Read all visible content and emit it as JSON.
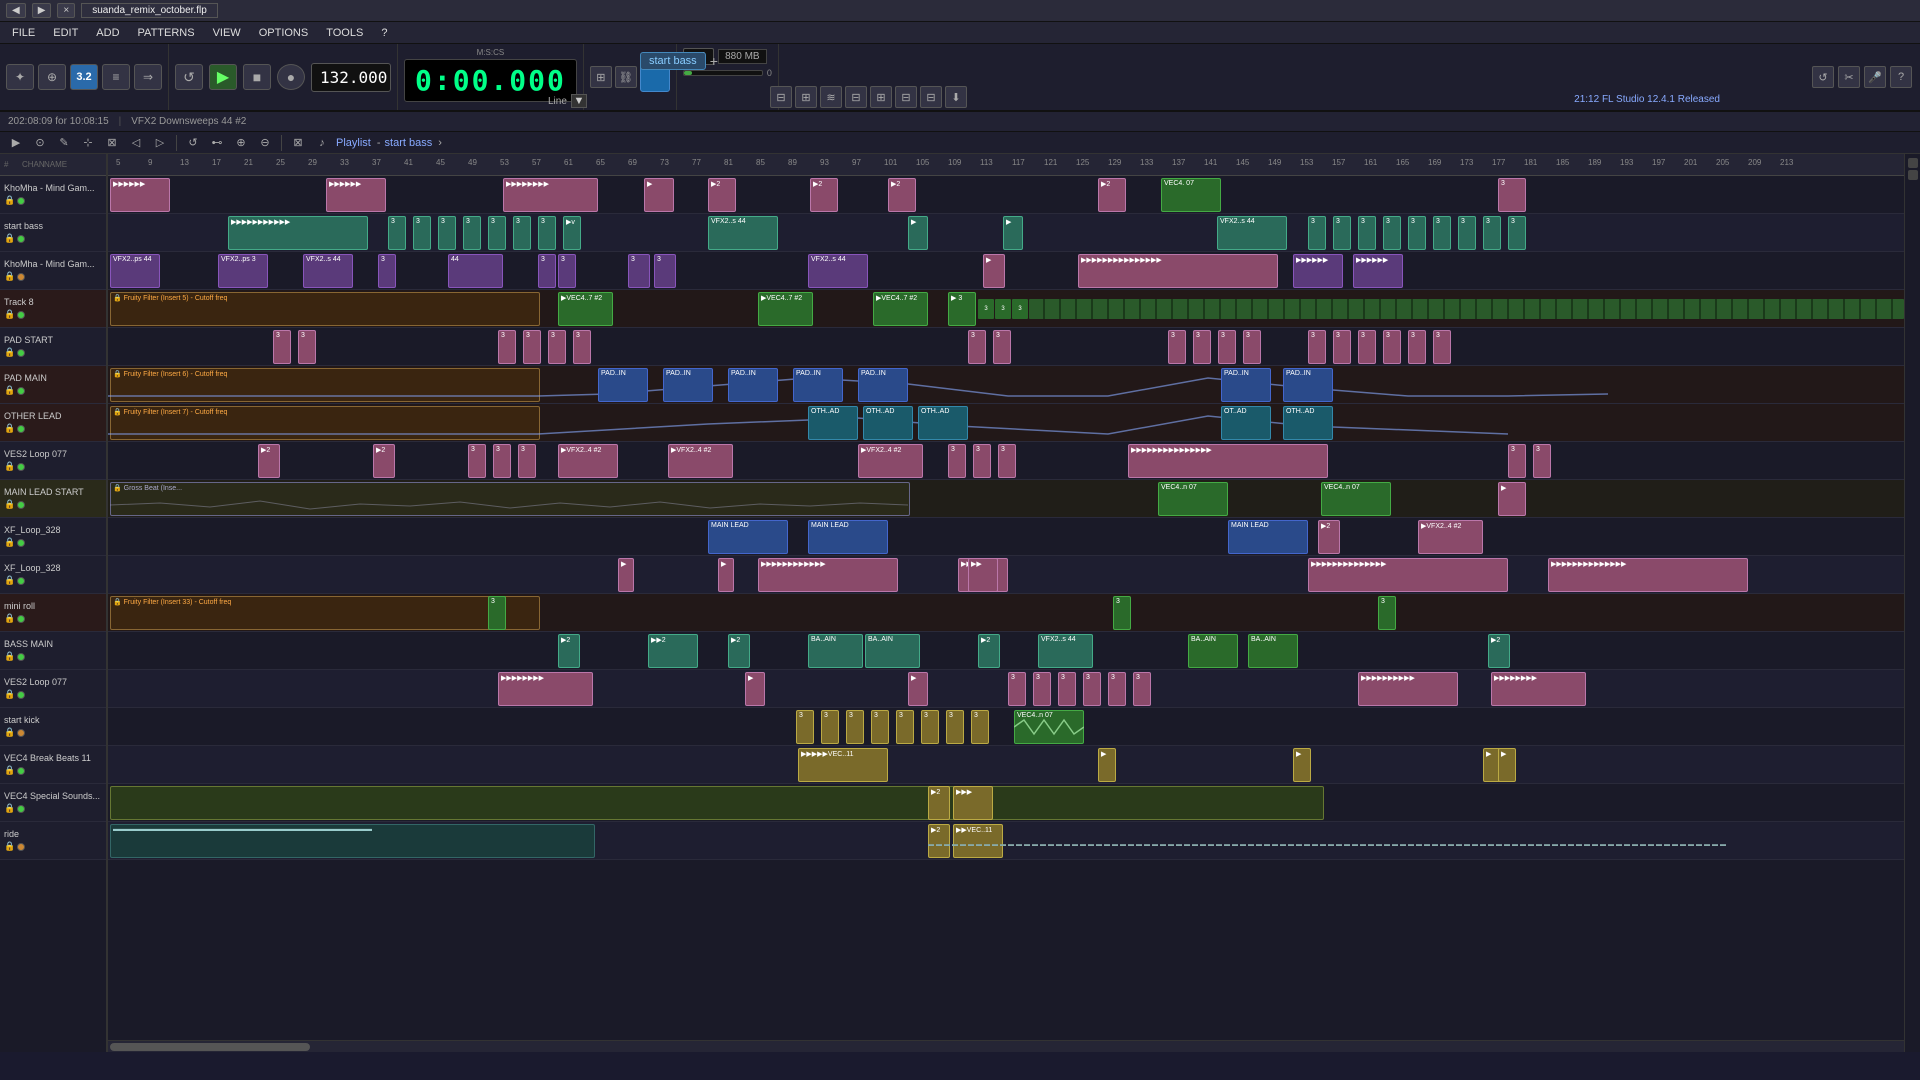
{
  "titleBar": {
    "tabClose": "×",
    "tabTitle": "suanda_remix_october.flp"
  },
  "menuBar": {
    "items": [
      "FILE",
      "EDIT",
      "ADD",
      "PATTERNS",
      "VIEW",
      "OPTIONS",
      "TOOLS",
      "?"
    ]
  },
  "transport": {
    "time": "0:00.000",
    "bpm": "132.000",
    "beats": "3.2",
    "counter": "17",
    "memory": "880 MB",
    "cpu": "0",
    "playlistLabel": "Playlist - start bass",
    "startBass": "start bass",
    "flVersion": "21:12  FL Studio 12.4.1 Released",
    "lineMode": "Line"
  },
  "infoBar": {
    "datetime": "202:08:09 for 10:08:15",
    "patch": "VFX2 Downsweeps 44 #2"
  },
  "ruler": {
    "marks": [
      5,
      9,
      13,
      17,
      21,
      25,
      29,
      33,
      37,
      41,
      45,
      49,
      53,
      57,
      61,
      65,
      69,
      73,
      77,
      81,
      85,
      89,
      93,
      97,
      101,
      105,
      109,
      113,
      117,
      121,
      125,
      129,
      133,
      137,
      141,
      145,
      149,
      153,
      157,
      161,
      165,
      169,
      173,
      177,
      181,
      185,
      189,
      193,
      197,
      201,
      205,
      209,
      213
    ]
  },
  "tracks": [
    {
      "name": "KhoMha - Mind Gam...",
      "color": "green",
      "dot": "green",
      "index": 1
    },
    {
      "name": "start bass",
      "color": "teal",
      "dot": "green",
      "index": 2
    },
    {
      "name": "KhoMha - Mind Gam...",
      "color": "purple",
      "dot": "orange",
      "index": 3
    },
    {
      "name": "Track 8",
      "color": "filter",
      "dot": "green",
      "index": 4
    },
    {
      "name": "PAD START",
      "color": "pink",
      "dot": "green",
      "index": 5
    },
    {
      "name": "PAD MAIN",
      "color": "filter2",
      "dot": "green",
      "index": 6
    },
    {
      "name": "OTHER LEAD",
      "color": "filter3",
      "dot": "green",
      "index": 7
    },
    {
      "name": "VES2 Loop 077",
      "color": "blue",
      "dot": "green",
      "index": 8
    },
    {
      "name": "MAIN LEAD START",
      "color": "gray",
      "dot": "green",
      "index": 9
    },
    {
      "name": "XF_Loop_328",
      "color": "pink2",
      "dot": "green",
      "index": 10
    },
    {
      "name": "XF_Loop_328",
      "color": "pink3",
      "dot": "green",
      "index": 11
    },
    {
      "name": "mini roll",
      "color": "filter4",
      "dot": "green",
      "index": 12
    },
    {
      "name": "BASS MAIN",
      "color": "teal2",
      "dot": "green",
      "index": 13
    },
    {
      "name": "VES2 Loop 077",
      "color": "pink4",
      "dot": "green",
      "index": 14
    },
    {
      "name": "start kick",
      "color": "yellow",
      "dot": "orange",
      "index": 15
    },
    {
      "name": "VEC4 Break Beats 11",
      "color": "yellow2",
      "dot": "green",
      "index": 16
    },
    {
      "name": "VEC4 Special Sounds...",
      "color": "light",
      "dot": "green",
      "index": 17
    },
    {
      "name": "ride",
      "color": "light2",
      "dot": "orange",
      "index": 18
    }
  ],
  "patterns": {
    "track1": "KhoMha - Mind Gam...",
    "track2": "start bass",
    "filterLabel1": "Fruity Filter (Insert 5) - Cutoff freq",
    "filterLabel2": "Fruity Filter (Insert 6) - Cutoff freq",
    "filterLabel3": "Fruity Filter (Insert 7) - Cutoff freq",
    "filterLabel4": "Fruity Filter (Insert 33) - Cutoff freq",
    "grossBeat": "Gross Beat (Inse...",
    "mainLead": "MAIN LEAD",
    "vec411": "VEC4..11",
    "vec407": "VEC4..n 07",
    "padIn": "PAD..IN",
    "othAd": "OTH..AD",
    "vfx2s44": "VFX2..s 44",
    "baAin": "BA..AIN"
  }
}
